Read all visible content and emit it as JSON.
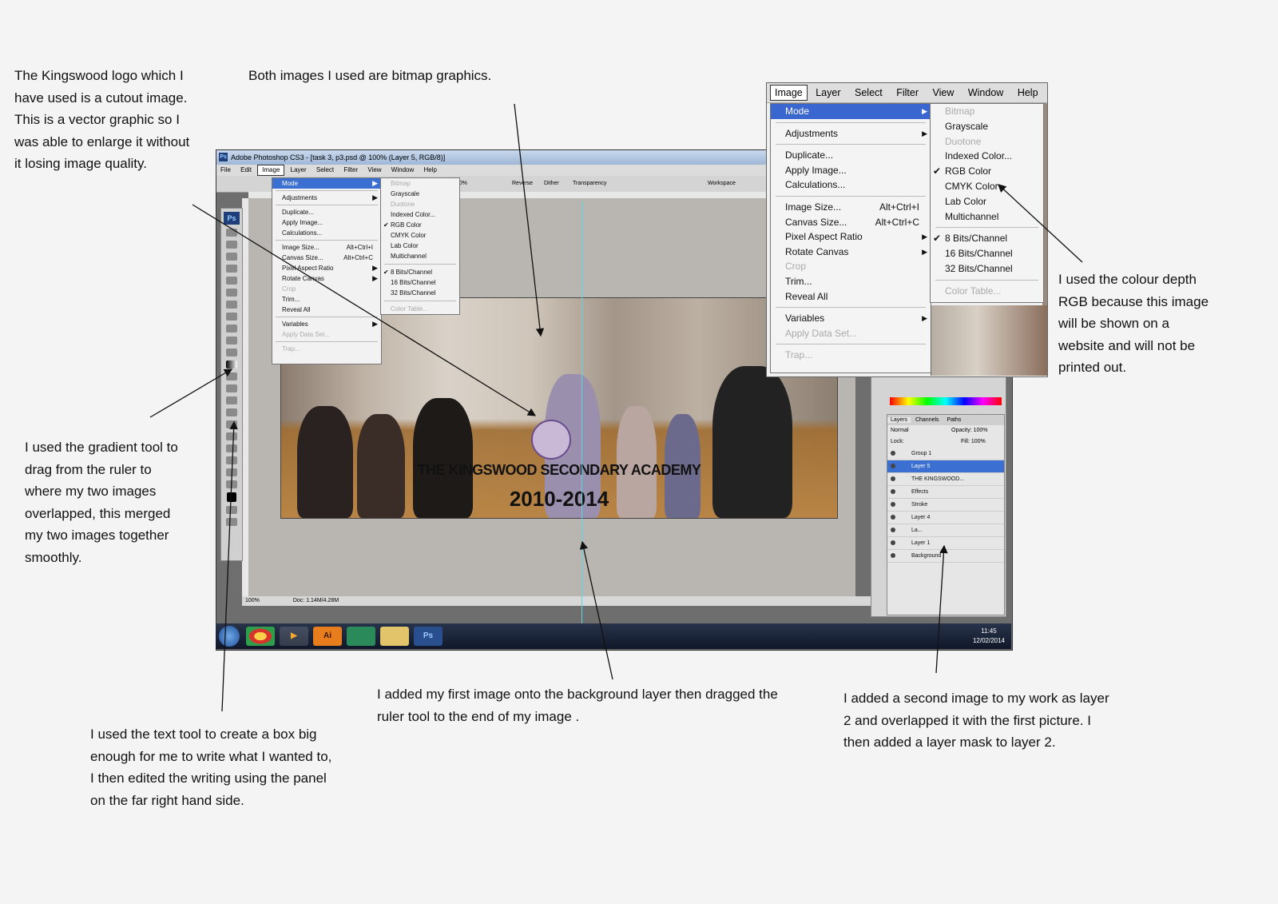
{
  "annotations": {
    "logo_note": [
      "The Kingswood logo which I",
      "have used is a cutout image.",
      "This is a vector graphic so I",
      "was able to enlarge it without",
      "it losing image quality."
    ],
    "bitmap_note": [
      "Both images I used are bitmap graphics."
    ],
    "gradient_note": [
      "I used the gradient tool to",
      "drag from the ruler to",
      "where my two images",
      "overlapped, this merged",
      "my two images together",
      "smoothly."
    ],
    "text_tool_note": [
      "I used the text tool to create a box big",
      "enough for me to write what I wanted to,",
      "I then edited the writing using the panel",
      "on the far right hand side."
    ],
    "ruler_note": [
      "I added my first image onto the background layer then dragged the",
      "ruler tool to the end of my image ."
    ],
    "layer_note": [
      "I added a second image to my work as layer",
      "2 and overlapped it with the first picture. I",
      "then added a layer mask to layer 2."
    ],
    "rgb_note": [
      "I used the colour depth",
      "RGB because this image",
      "will be shown on a",
      "website and will not be",
      "printed out."
    ]
  },
  "photoshop": {
    "title": "Adobe Photoshop CS3 - [task 3, p3.psd @ 100% (Layer 5, RGB/8)]",
    "menubar": [
      "File",
      "Edit",
      "Image",
      "Layer",
      "Select",
      "Filter",
      "View",
      "Window",
      "Help"
    ],
    "options": {
      "opacity": "100%",
      "reverse": "Reverse",
      "dither": "Dither",
      "transparency": "Transparency",
      "workspace": "Workspace"
    },
    "status": {
      "zoom": "100%",
      "doc": "Doc: 1.14M/4.28M"
    },
    "artwork": {
      "title": "THE KINGSWOOD SECONDARY ACADEMY",
      "years": "2010-2014"
    },
    "image_menu": [
      {
        "label": "Mode",
        "state": "highlight"
      },
      {
        "sep": true
      },
      {
        "label": "Adjustments"
      },
      {
        "sep": true
      },
      {
        "label": "Duplicate..."
      },
      {
        "label": "Apply Image..."
      },
      {
        "label": "Calculations..."
      },
      {
        "sep": true
      },
      {
        "label": "Image Size...",
        "shortcut": "Alt+Ctrl+I"
      },
      {
        "label": "Canvas Size...",
        "shortcut": "Alt+Ctrl+C"
      },
      {
        "label": "Pixel Aspect Ratio"
      },
      {
        "label": "Rotate Canvas"
      },
      {
        "label": "Crop",
        "state": "disabled"
      },
      {
        "label": "Trim..."
      },
      {
        "label": "Reveal All"
      },
      {
        "sep": true
      },
      {
        "label": "Variables"
      },
      {
        "label": "Apply Data Set...",
        "state": "disabled"
      },
      {
        "sep": true
      },
      {
        "label": "Trap...",
        "state": "disabled"
      }
    ],
    "mode_submenu": [
      {
        "label": "Bitmap",
        "state": "disabled"
      },
      {
        "label": "Grayscale"
      },
      {
        "label": "Duotone",
        "state": "disabled"
      },
      {
        "label": "Indexed Color..."
      },
      {
        "label": "RGB Color",
        "checked": true
      },
      {
        "label": "CMYK Color"
      },
      {
        "label": "Lab Color"
      },
      {
        "label": "Multichannel"
      },
      {
        "sep": true
      },
      {
        "label": "8 Bits/Channel",
        "checked": true
      },
      {
        "label": "16 Bits/Channel"
      },
      {
        "label": "32 Bits/Channel"
      },
      {
        "sep": true
      },
      {
        "label": "Color Table...",
        "state": "disabled"
      }
    ],
    "layers_panel": {
      "tabs": [
        "Layers",
        "Channels",
        "Paths"
      ],
      "blend": "Normal",
      "opacity": "Opacity: 100%",
      "fill": "Fill: 100%",
      "lock": "Lock:",
      "rows": [
        {
          "label": "Group 1"
        },
        {
          "label": "Layer 5",
          "selected": true
        },
        {
          "label": "THE KINGSWOOD..."
        },
        {
          "label": "Effects"
        },
        {
          "label": "Stroke"
        },
        {
          "label": "Layer 4"
        },
        {
          "label": "La..."
        },
        {
          "label": "Layer 1"
        },
        {
          "label": "Background"
        }
      ]
    },
    "taskbar": {
      "time": "11:45",
      "date": "12/02/2014",
      "apps": [
        "Ai",
        "Ps"
      ]
    }
  },
  "zoomed_menu": {
    "menubar": [
      "Image",
      "Layer",
      "Select",
      "Filter",
      "View",
      "Window",
      "Help"
    ],
    "image_menu": [
      {
        "label": "Mode",
        "state": "highlight"
      },
      {
        "sep": true
      },
      {
        "label": "Adjustments"
      },
      {
        "sep": true
      },
      {
        "label": "Duplicate..."
      },
      {
        "label": "Apply Image..."
      },
      {
        "label": "Calculations..."
      },
      {
        "sep": true
      },
      {
        "label": "Image Size...",
        "shortcut": "Alt+Ctrl+I"
      },
      {
        "label": "Canvas Size...",
        "shortcut": "Alt+Ctrl+C"
      },
      {
        "label": "Pixel Aspect Ratio"
      },
      {
        "label": "Rotate Canvas"
      },
      {
        "label": "Crop",
        "state": "disabled"
      },
      {
        "label": "Trim..."
      },
      {
        "label": "Reveal All"
      },
      {
        "sep": true
      },
      {
        "label": "Variables"
      },
      {
        "label": "Apply Data Set...",
        "state": "disabled"
      },
      {
        "sep": true
      },
      {
        "label": "Trap...",
        "state": "disabled"
      }
    ],
    "mode_submenu": [
      {
        "label": "Bitmap",
        "state": "disabled"
      },
      {
        "label": "Grayscale"
      },
      {
        "label": "Duotone",
        "state": "disabled"
      },
      {
        "label": "Indexed Color..."
      },
      {
        "label": "RGB Color",
        "checked": true
      },
      {
        "label": "CMYK Color"
      },
      {
        "label": "Lab Color"
      },
      {
        "label": "Multichannel"
      },
      {
        "sep": true
      },
      {
        "label": "8 Bits/Channel",
        "checked": true
      },
      {
        "label": "16 Bits/Channel"
      },
      {
        "label": "32 Bits/Channel"
      },
      {
        "sep": true
      },
      {
        "label": "Color Table...",
        "state": "disabled"
      }
    ]
  }
}
